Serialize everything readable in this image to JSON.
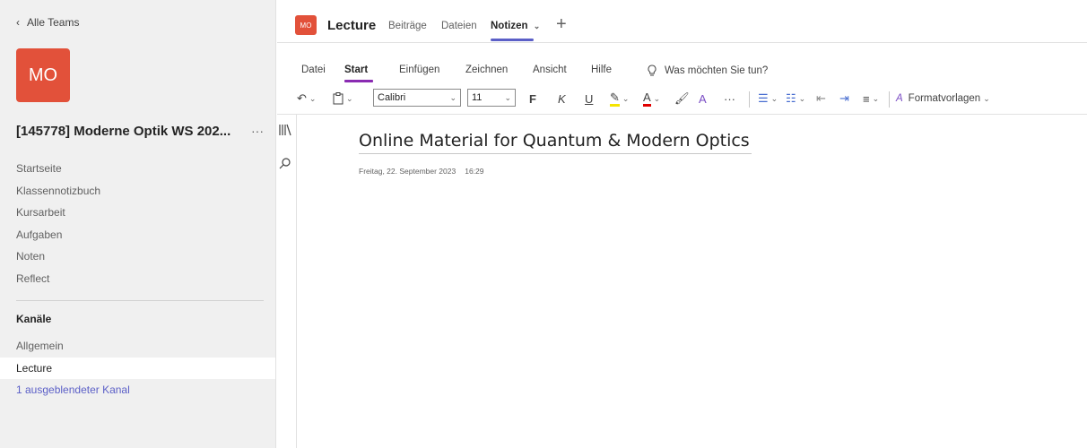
{
  "sidebar": {
    "back_label": "Alle Teams",
    "team_avatar": "MO",
    "team_name": "[145778] Moderne Optik WS 202...",
    "more": "···",
    "nav": [
      "Startseite",
      "Klassennotizbuch",
      "Kursarbeit",
      "Aufgaben",
      "Noten",
      "Reflect"
    ],
    "channels_title": "Kanäle",
    "channels": [
      "Allgemein",
      "Lecture"
    ],
    "hidden_channels": "1 ausgeblendeter Kanal"
  },
  "header": {
    "avatar": "MO",
    "channel_name": "Lecture",
    "tabs": [
      "Beiträge",
      "Dateien",
      "Notizen"
    ]
  },
  "ribbon": {
    "tabs": [
      "Datei",
      "Start",
      "Einfügen",
      "Zeichnen",
      "Ansicht",
      "Hilfe"
    ],
    "search_hint": "Was möchten Sie tun?"
  },
  "toolbar": {
    "font": "Calibri",
    "size": "11",
    "bold": "F",
    "italic": "K",
    "underline": "U",
    "more": "···",
    "styles": "Formatvorlagen"
  },
  "page": {
    "title": "Online Material for Quantum & Modern Optics",
    "date": "Freitag, 22. September 2023",
    "time": "16:29"
  },
  "colors": {
    "team_accent": "#e2513a",
    "tab_accent": "#5b5fc7",
    "ribbon_accent": "#8a2bb2"
  }
}
